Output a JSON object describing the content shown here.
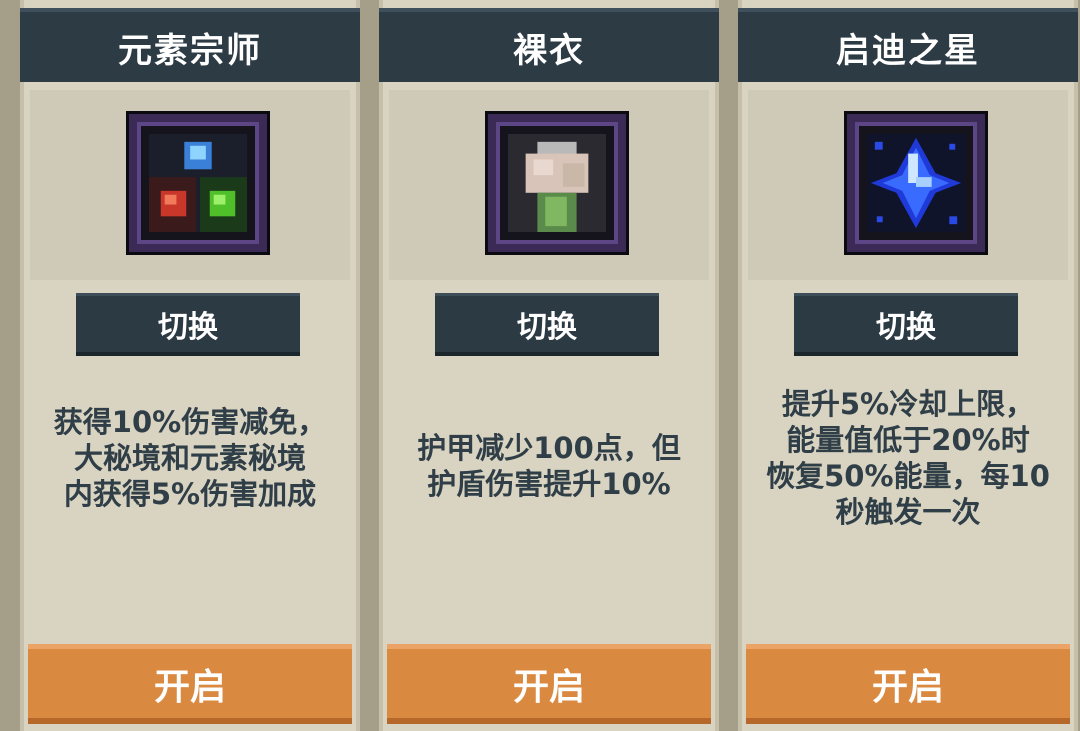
{
  "cards": [
    {
      "title": "元素宗师",
      "icon": "elemental-orbs-icon",
      "switch_label": "切换",
      "description": "获得10%伤害减免，\n大秘境和元素秘境\n内获得5%伤害加成",
      "open_label": "开启"
    },
    {
      "title": "裸衣",
      "icon": "bare-clothes-icon",
      "switch_label": "切换",
      "description": "护甲减少100点，但\n护盾伤害提升10%",
      "open_label": "开启"
    },
    {
      "title": "启迪之星",
      "icon": "blue-star-crystal-icon",
      "switch_label": "切换",
      "description": "提升5%冷却上限，\n能量值低于20%时\n恢复50%能量，每10\n秒触发一次",
      "open_label": "开启"
    }
  ],
  "colors": {
    "header_bg": "#2d3b45",
    "panel_bg": "#d9d4c2",
    "button_orange": "#d98940",
    "text_dark": "#2f3e47"
  }
}
